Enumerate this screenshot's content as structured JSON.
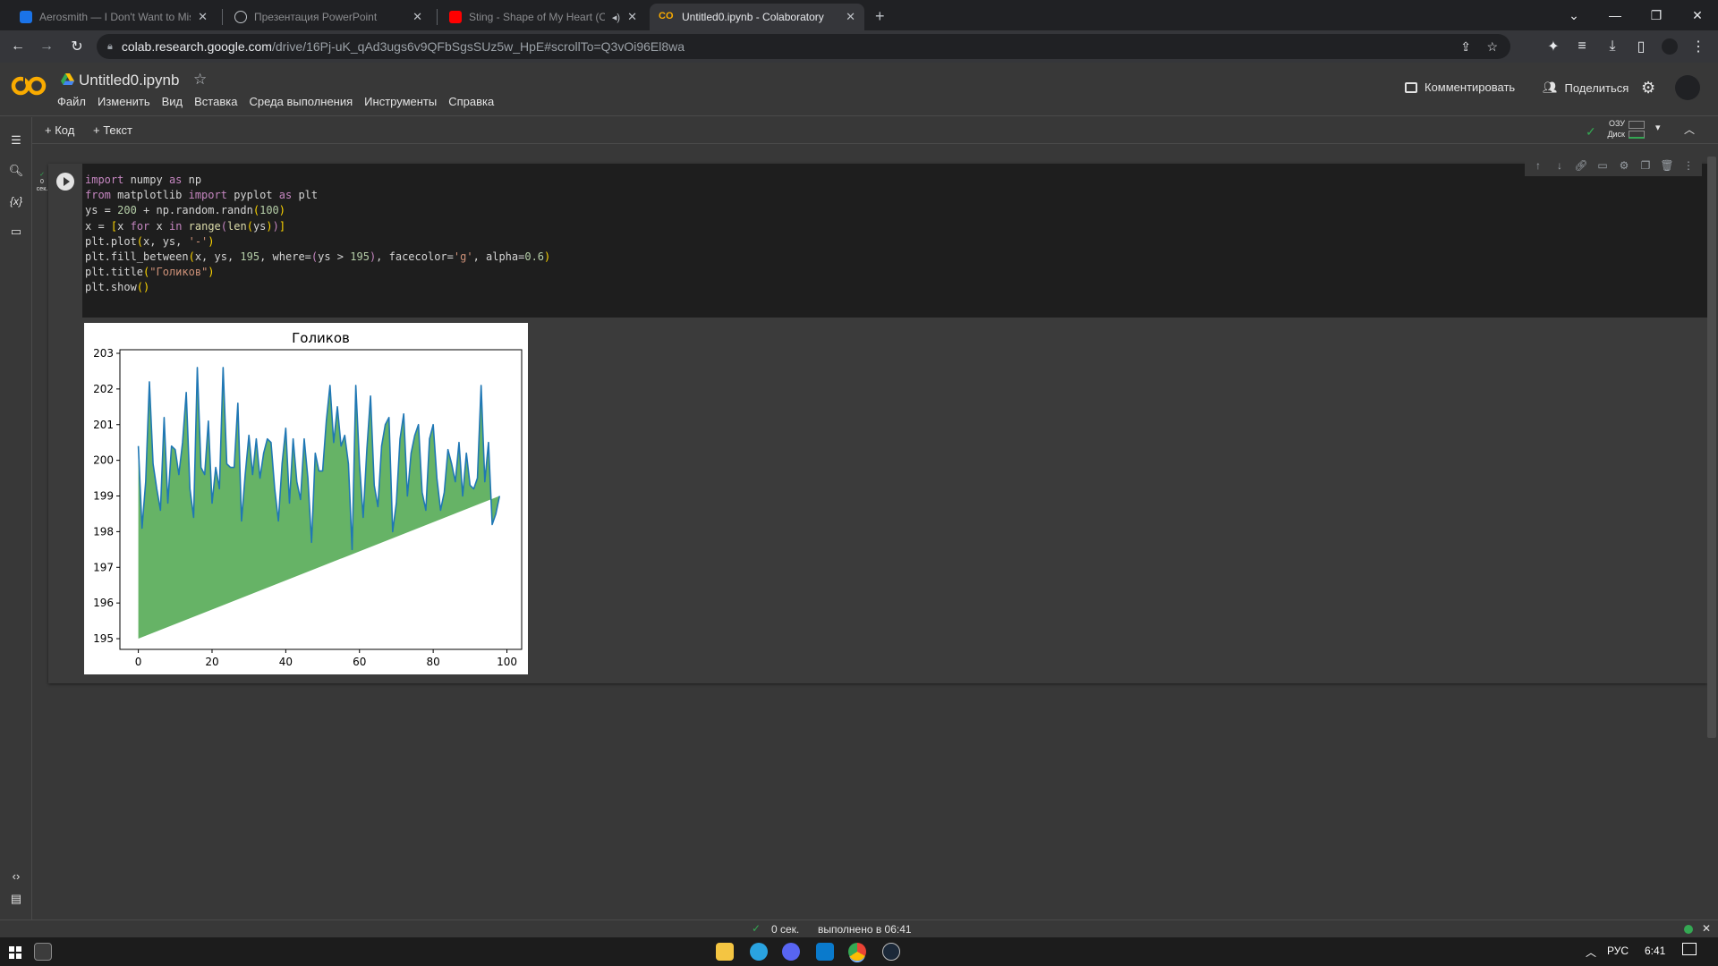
{
  "browser": {
    "tabs": [
      {
        "title": "Aerosmith — I Don't Want to Miss",
        "icon": "music-icon",
        "color": "#1a73e8"
      },
      {
        "title": "Презентация PowerPoint",
        "icon": "globe-icon",
        "color": "#bdc1c6"
      },
      {
        "title": "Sting - Shape of My Heart (O",
        "icon": "youtube-icon",
        "color": "#ff0000"
      },
      {
        "title": "Untitled0.ipynb - Colaboratory",
        "icon": "colab-icon",
        "color": "#f9ab00"
      }
    ],
    "url_domain": "colab.research.google.com",
    "url_path": "/drive/16Pj-uK_qAd3ugs6v9QFbSgsSUz5w_HpE#scrollTo=Q3vOi96El8wa"
  },
  "header": {
    "notebook_title": "Untitled0.ipynb",
    "menu": [
      "Файл",
      "Изменить",
      "Вид",
      "Вставка",
      "Среда выполнения",
      "Инструменты",
      "Справка"
    ],
    "comment_label": "Комментировать",
    "share_label": "Поделиться"
  },
  "toolbar": {
    "add_code": "+ Код",
    "add_text": "+ Текст",
    "ram_label": "ОЗУ",
    "disk_label": "Диск"
  },
  "cell": {
    "exec_time": "0",
    "exec_unit": "сек.",
    "code_lines": [
      "import numpy as np",
      "from matplotlib import pyplot as plt",
      "ys = 200 + np.random.randn(100)",
      "x = [x for x in range(len(ys))]",
      "plt.plot(x, ys, '-')",
      "plt.fill_between(x, ys, 195, where=(ys > 195), facecolor='g', alpha=0.6)",
      "plt.title(\"Голиков\")",
      "plt.show()"
    ]
  },
  "status": {
    "duration": "0 сек.",
    "completed": "выполнено в 06:41"
  },
  "taskbar": {
    "lang": "РУС",
    "time": "6:41"
  },
  "chart_data": {
    "type": "area",
    "title": "Голиков",
    "xlabel": "",
    "ylabel": "",
    "xlim": [
      -5,
      104
    ],
    "ylim": [
      194.7,
      203.1
    ],
    "xticks": [
      0,
      20,
      40,
      60,
      80,
      100
    ],
    "yticks": [
      195,
      196,
      197,
      198,
      199,
      200,
      201,
      202,
      203
    ],
    "fill_base": 195,
    "line_color": "#1f77b4",
    "fill_color": "#66b366",
    "grid": false,
    "x": [
      0,
      1,
      2,
      3,
      4,
      5,
      6,
      7,
      8,
      9,
      10,
      11,
      12,
      13,
      14,
      15,
      16,
      17,
      18,
      19,
      20,
      21,
      22,
      23,
      24,
      25,
      26,
      27,
      28,
      29,
      30,
      31,
      32,
      33,
      34,
      35,
      36,
      37,
      38,
      39,
      40,
      41,
      42,
      43,
      44,
      45,
      46,
      47,
      48,
      49,
      50,
      51,
      52,
      53,
      54,
      55,
      56,
      57,
      58,
      59,
      60,
      61,
      62,
      63,
      64,
      65,
      66,
      67,
      68,
      69,
      70,
      71,
      72,
      73,
      74,
      75,
      76,
      77,
      78,
      79,
      80,
      81,
      82,
      83,
      84,
      85,
      86,
      87,
      88,
      89,
      90,
      91,
      92,
      93,
      94,
      95,
      96,
      97,
      98,
      99
    ],
    "y": [
      200.4,
      198.1,
      199.4,
      202.2,
      199.9,
      199.2,
      198.6,
      201.2,
      198.8,
      200.4,
      200.3,
      199.6,
      200.5,
      201.9,
      199.2,
      198.4,
      202.6,
      199.8,
      199.6,
      201.1,
      198.8,
      199.8,
      199.2,
      202.6,
      199.9,
      199.8,
      199.8,
      201.6,
      198.3,
      199.6,
      200.7,
      199.6,
      200.6,
      199.5,
      200.2,
      200.6,
      200.5,
      199.2,
      198.3,
      199.9,
      200.9,
      198.8,
      200.6,
      199.4,
      198.9,
      200.6,
      199.5,
      197.7,
      200.2,
      199.7,
      199.7,
      201.1,
      202.1,
      200.5,
      201.5,
      200.4,
      200.7,
      199.9,
      197.5,
      202.1,
      199.9,
      198.4,
      200.3,
      201.8,
      199.3,
      198.7,
      200.4,
      201.0,
      201.2,
      198.0,
      198.8,
      200.6,
      201.3,
      199.0,
      200.2,
      200.7,
      201.0,
      199.1,
      198.6,
      200.6,
      201.0,
      199.5,
      198.6,
      199.1,
      200.3,
      199.9,
      199.4,
      200.5,
      199.0,
      200.2,
      199.3,
      199.2,
      199.5,
      202.1,
      199.4,
      200.5,
      198.2,
      198.5,
      199.0
    ]
  }
}
